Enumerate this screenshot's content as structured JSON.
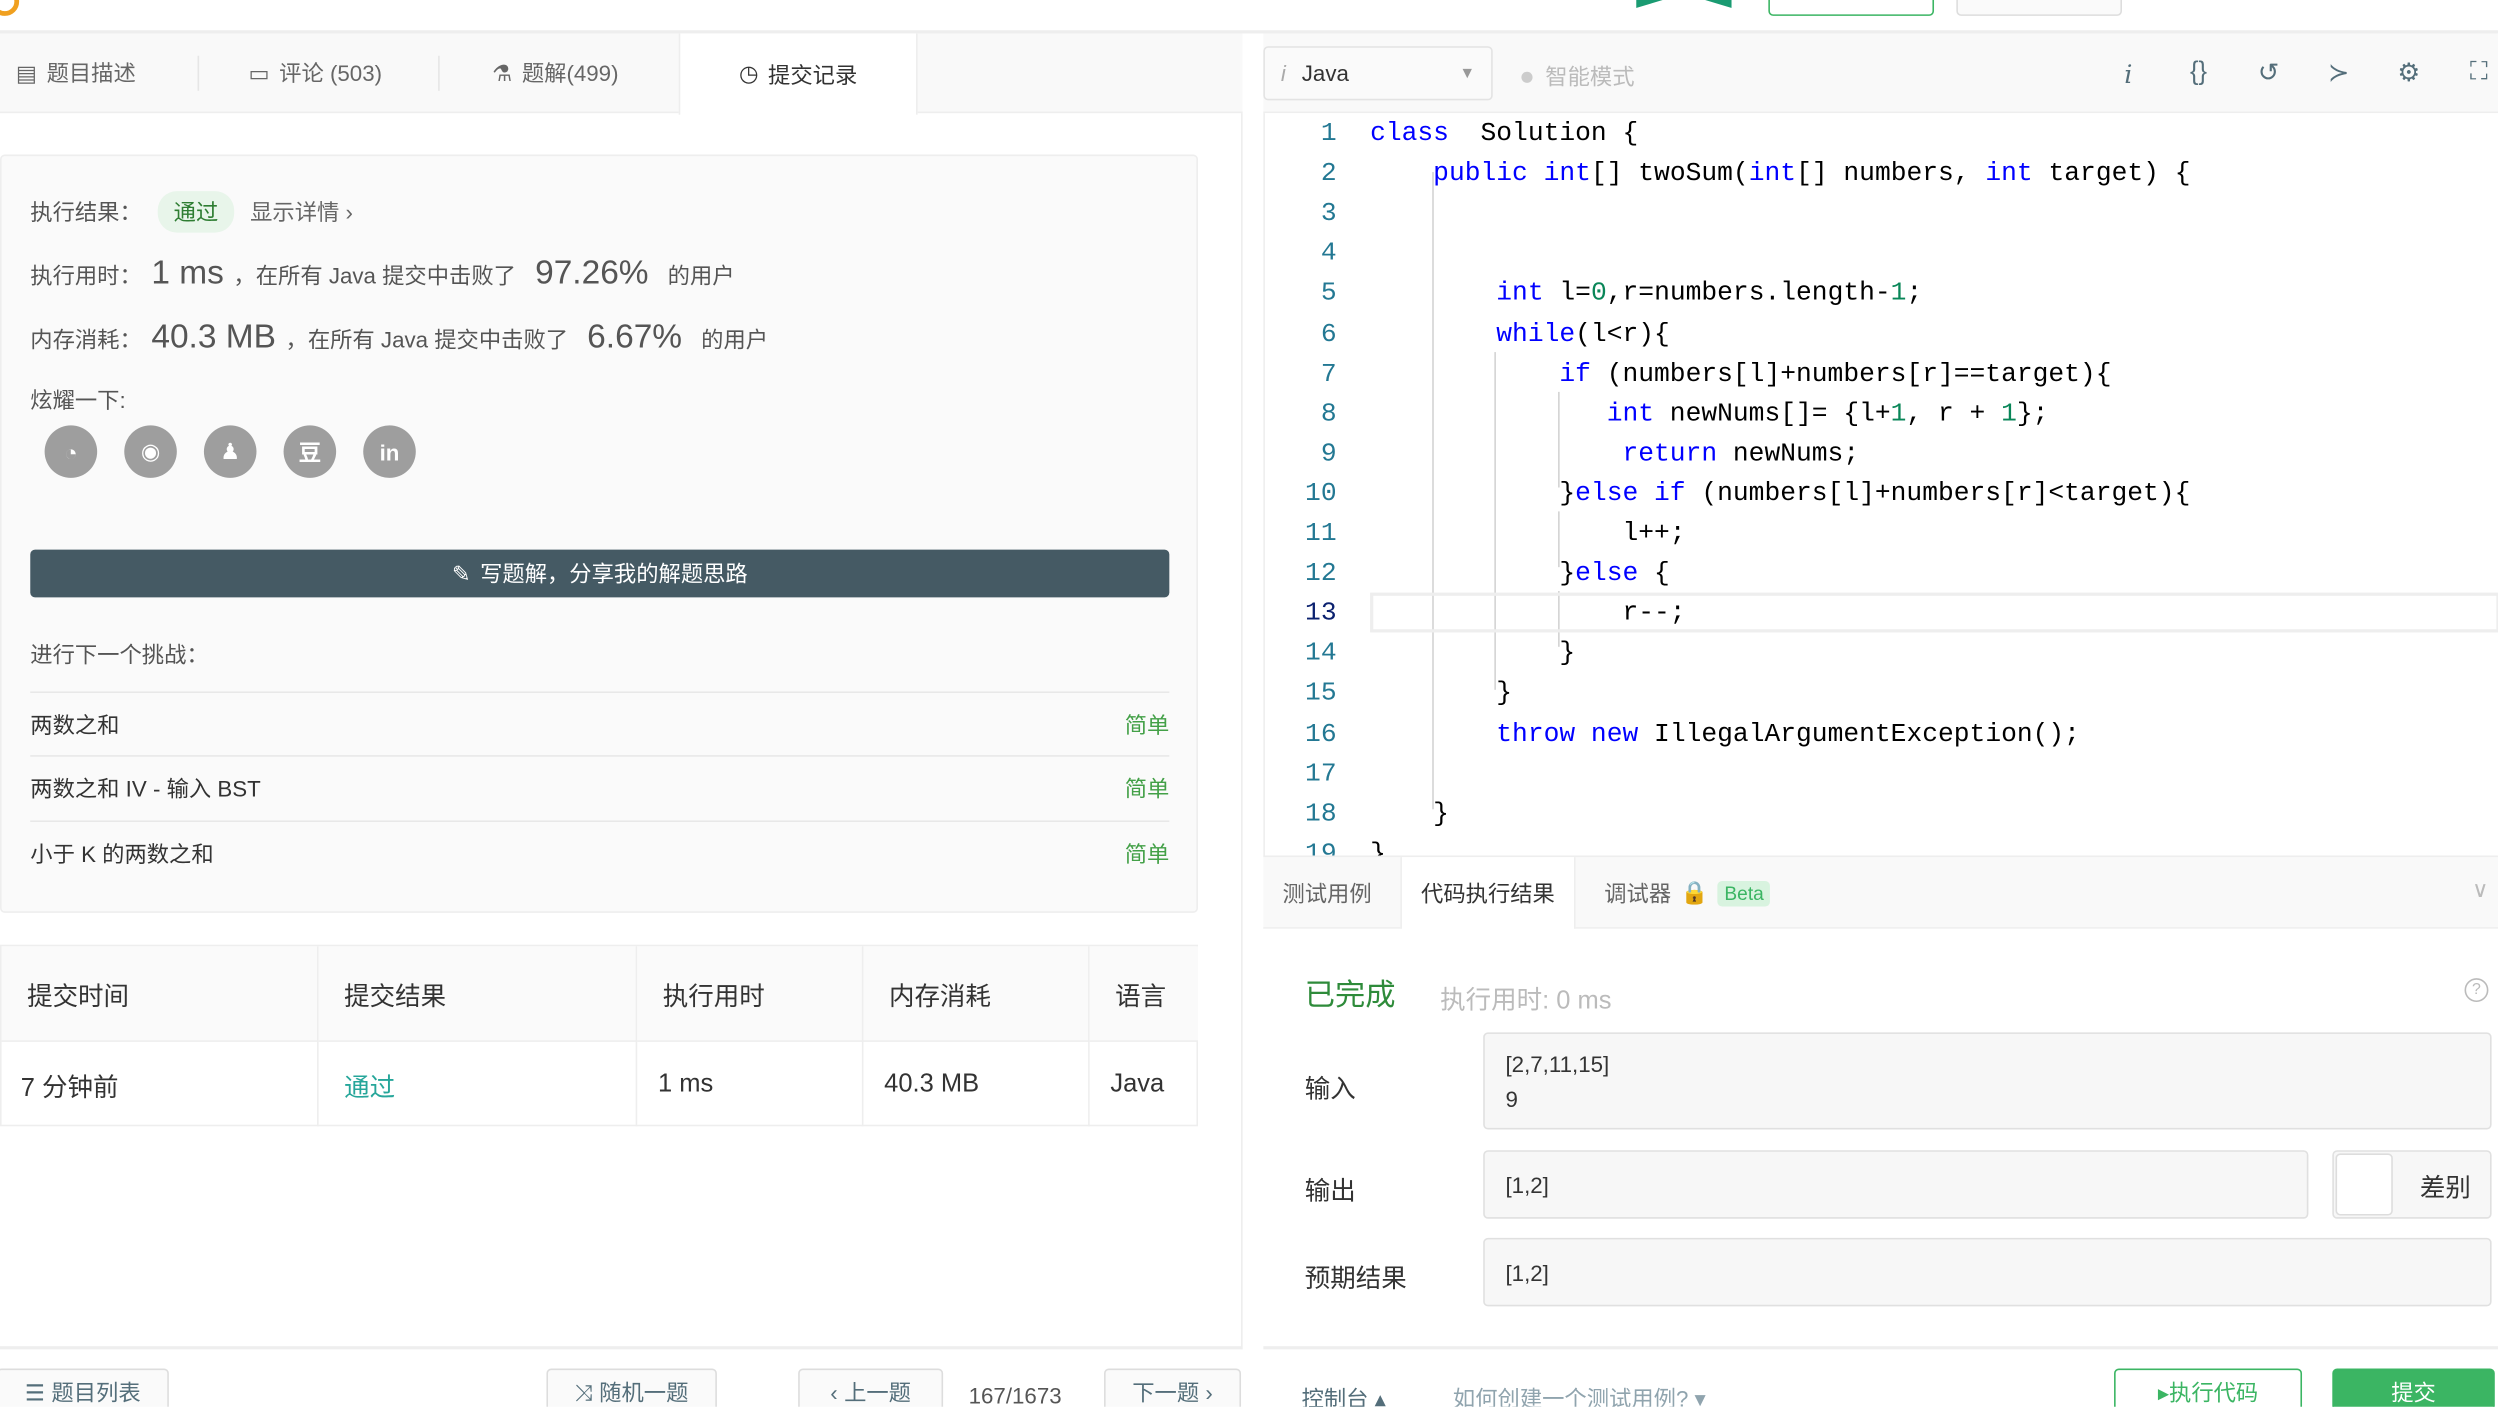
{
  "tabs": [
    {
      "label": "题目描述",
      "icon": "description-icon"
    },
    {
      "label": "评论 (503)",
      "icon": "comment-icon"
    },
    {
      "label": "题解(499)",
      "icon": "flask-icon"
    },
    {
      "label": "提交记录",
      "icon": "clock-icon"
    }
  ],
  "result": {
    "result_label": "执行结果：",
    "status": "通过",
    "details_link": "显示详情 ›",
    "time_label": "执行用时：",
    "time_value": "1 ms",
    "time_text": "，在所有 Java 提交中击败了",
    "time_percent": "97.26%",
    "users_text": "的用户",
    "mem_label": "内存消耗：",
    "mem_value": "40.3 MB",
    "mem_text": "，在所有 Java 提交中击败了",
    "mem_percent": "6.67%",
    "share_label": "炫耀一下:",
    "share_icons": [
      "wechat-icon",
      "weibo-icon",
      "qq-icon",
      "douban-icon",
      "linkedin-icon"
    ],
    "write_button": "写题解，分享我的解题思路",
    "next_label": "进行下一个挑战：",
    "challenges": [
      {
        "title": "两数之和",
        "difficulty": "简单"
      },
      {
        "title": "两数之和 IV - 输入 BST",
        "difficulty": "简单"
      },
      {
        "title": "小于 K 的两数之和",
        "difficulty": "简单"
      }
    ]
  },
  "submissions": {
    "headers": [
      "提交时间",
      "提交结果",
      "执行用时",
      "内存消耗",
      "语言"
    ],
    "rows": [
      [
        "7 分钟前",
        "通过",
        "1 ms",
        "40.3 MB",
        "Java"
      ]
    ]
  },
  "bottom_nav": {
    "problem_list": "题目列表",
    "random": "随机一题",
    "prev": "上一题",
    "page": "167/1673",
    "next": "下一题 ›"
  },
  "editor": {
    "language": "Java",
    "smart_mode": "智能模式",
    "current_line": 13,
    "lines": [
      [
        [
          "kw",
          "class"
        ],
        [
          "",
          "  Solution {"
        ]
      ],
      [
        [
          "",
          "    "
        ],
        [
          "kw",
          "public"
        ],
        [
          "",
          " "
        ],
        [
          "kw",
          "int"
        ],
        [
          "",
          "[] twoSum("
        ],
        [
          "kw",
          "int"
        ],
        [
          "",
          "[] numbers, "
        ],
        [
          "kw",
          "int"
        ],
        [
          "",
          " target) {"
        ]
      ],
      [],
      [],
      [
        [
          "",
          "        "
        ],
        [
          "kw",
          "int"
        ],
        [
          "",
          " l="
        ],
        [
          "num",
          "0"
        ],
        [
          "",
          ",r=numbers.length-"
        ],
        [
          "num",
          "1"
        ],
        [
          "",
          ";"
        ]
      ],
      [
        [
          "",
          "        "
        ],
        [
          "kw",
          "while"
        ],
        [
          "",
          "(l<r){"
        ]
      ],
      [
        [
          "",
          "            "
        ],
        [
          "kw",
          "if"
        ],
        [
          "",
          " (numbers[l]+numbers[r]==target){"
        ]
      ],
      [
        [
          "",
          "               "
        ],
        [
          "kw",
          "int"
        ],
        [
          "",
          " newNums[]= {l+"
        ],
        [
          "num",
          "1"
        ],
        [
          "",
          ", r + "
        ],
        [
          "num",
          "1"
        ],
        [
          "",
          "};"
        ]
      ],
      [
        [
          "",
          "                "
        ],
        [
          "kw",
          "return"
        ],
        [
          "",
          " newNums;"
        ]
      ],
      [
        [
          "",
          "            }"
        ],
        [
          "kw",
          "else if"
        ],
        [
          "",
          " (numbers[l]+numbers[r]<target){"
        ]
      ],
      [
        [
          "",
          "                l++;"
        ]
      ],
      [
        [
          "",
          "            }"
        ],
        [
          "kw",
          "else"
        ],
        [
          "",
          " {"
        ]
      ],
      [
        [
          "",
          "                r--;"
        ]
      ],
      [
        [
          "",
          "            }"
        ]
      ],
      [
        [
          "",
          "        }"
        ]
      ],
      [
        [
          "",
          "        "
        ],
        [
          "kw",
          "throw"
        ],
        [
          "",
          " "
        ],
        [
          "kw",
          "new"
        ],
        [
          "",
          " IllegalArgumentException();"
        ]
      ],
      [],
      [
        [
          "",
          "    }"
        ]
      ],
      [
        [
          "",
          "}"
        ]
      ]
    ]
  },
  "console": {
    "tabs": [
      "测试用例",
      "代码执行结果",
      "调试器"
    ],
    "beta": "Beta",
    "status": "已完成",
    "exec_time": "执行用时: 0 ms",
    "input_label": "输入",
    "input_value": "[2,7,11,15]\n9",
    "output_label": "输出",
    "output_value": "[1,2]",
    "diff_label": "差别",
    "expected_label": "预期结果",
    "expected_value": "[1,2]"
  },
  "footer": {
    "console": "控制台 ▴",
    "howto": "如何创建一个测试用例? ▾",
    "run": "▸执行代码",
    "submit": "提交"
  },
  "colors": {
    "accent": "#3bb563",
    "pass": "#2e7d32",
    "dark_button": "#455a64"
  }
}
